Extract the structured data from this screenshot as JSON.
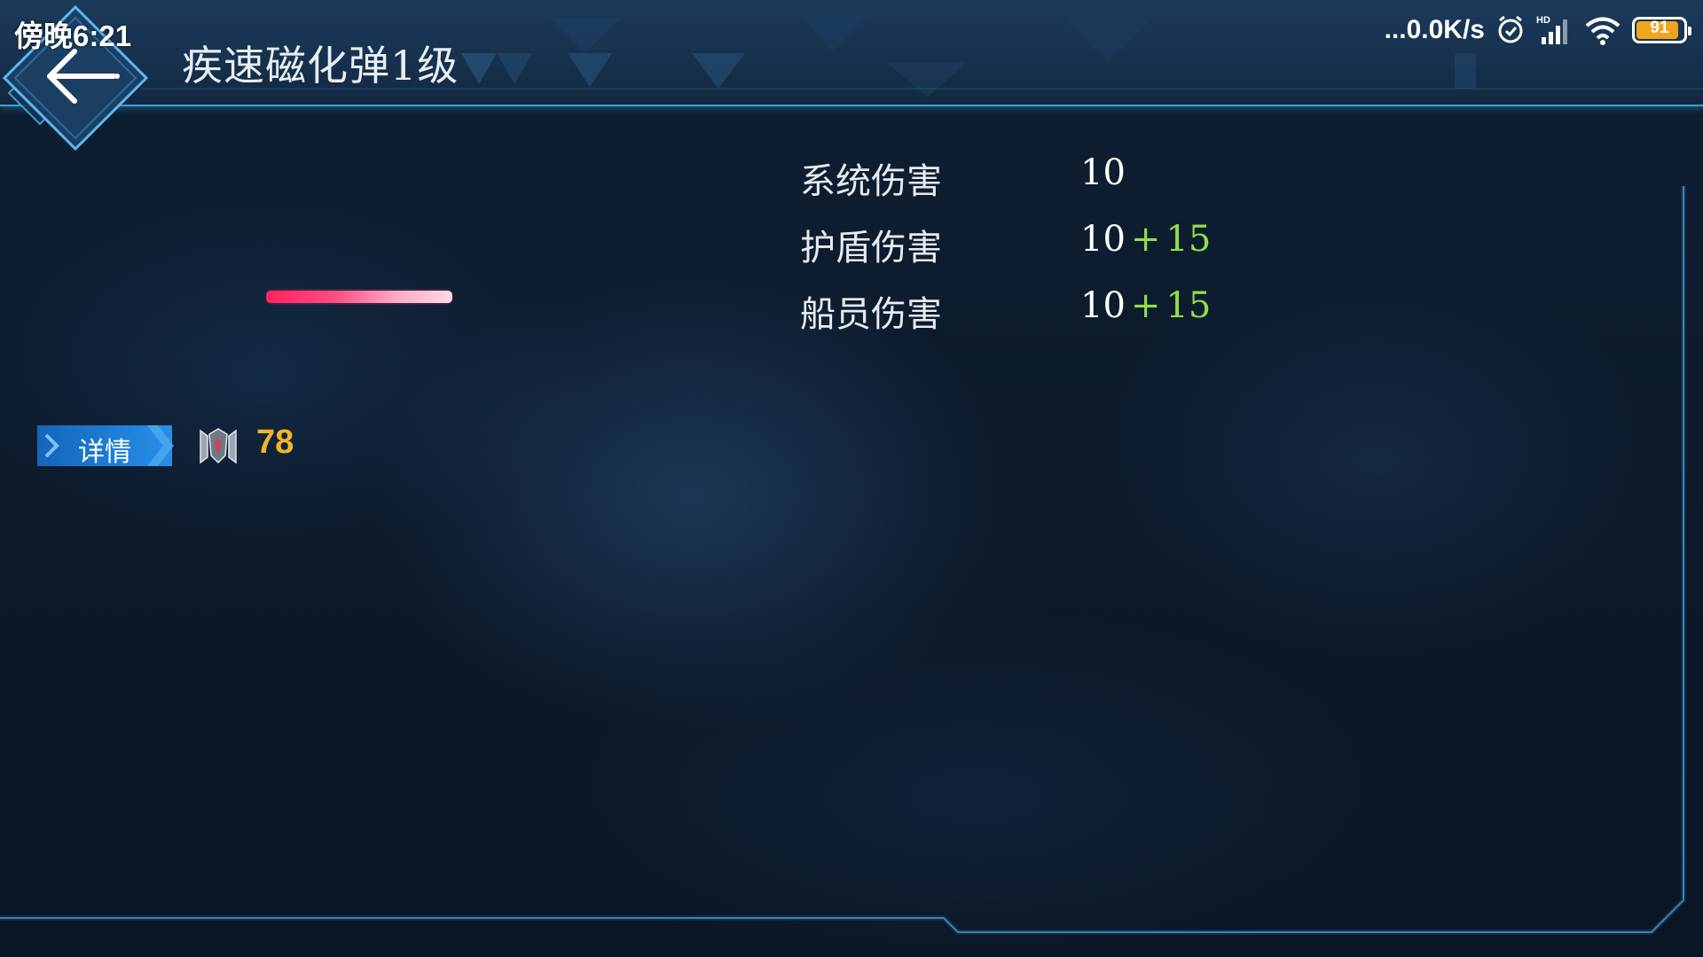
{
  "status_bar": {
    "time": "傍晚6:21",
    "net_speed": "...0.0K/s",
    "battery_level": "91",
    "battery_fraction": 0.91,
    "icons": [
      "alarm-icon",
      "hd-signal-icon",
      "wifi-icon",
      "battery-icon"
    ]
  },
  "header": {
    "title": "疾速磁化弹1级",
    "back_icon": "arrow-left-icon"
  },
  "stats": [
    {
      "label": "系统伤害",
      "base": "10",
      "plus": "",
      "bonus": ""
    },
    {
      "label": "护盾伤害",
      "base": "10",
      "plus": "+",
      "bonus": "15"
    },
    {
      "label": "船员伤害",
      "base": "10",
      "plus": "+",
      "bonus": "15"
    }
  ],
  "details": {
    "button_label": "详情",
    "power_icon": "ship-power-icon",
    "power_value": "78"
  },
  "colors": {
    "accent": "#3a9fd8",
    "bonus": "#8ee04a",
    "power": "#f0b52c",
    "button": "#1e7fd8",
    "projectile": "#ff2d6a"
  }
}
